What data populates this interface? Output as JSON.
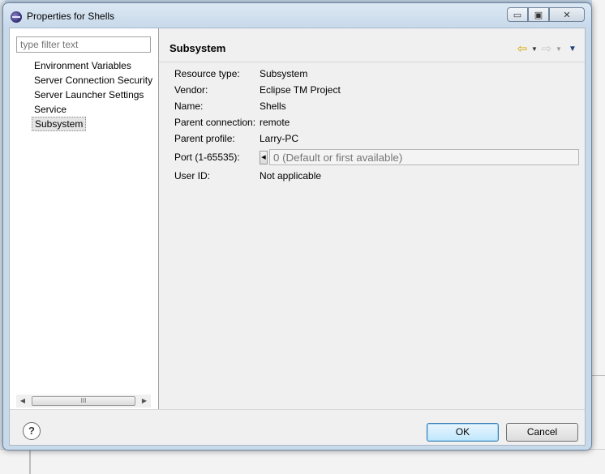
{
  "dialog": {
    "title": "Properties for Shells",
    "window_buttons": {
      "minimize": "▭",
      "maximize": "▣",
      "close": "✕"
    }
  },
  "sidebar": {
    "filter_placeholder": "type filter text",
    "items": [
      {
        "label": "Environment Variables"
      },
      {
        "label": "Server Connection Security"
      },
      {
        "label": "Server Launcher Settings"
      },
      {
        "label": "Service"
      },
      {
        "label": "Subsystem",
        "selected": true
      }
    ],
    "scroll_thumb": "III"
  },
  "page": {
    "title": "Subsystem",
    "properties": [
      {
        "label": "Resource type:",
        "value": "Subsystem"
      },
      {
        "label": "Vendor:",
        "value": "Eclipse TM Project"
      },
      {
        "label": "Name:",
        "value": "Shells"
      },
      {
        "label": "Parent connection:",
        "value": "remote"
      },
      {
        "label": "Parent profile:",
        "value": "Larry-PC"
      }
    ],
    "port": {
      "label": "Port (1-65535):",
      "placeholder": "0 (Default or first available)"
    },
    "user_id": {
      "label": "User ID:",
      "value": "Not applicable"
    }
  },
  "footer": {
    "help": "?",
    "ok_label": "OK",
    "cancel_label": "Cancel"
  },
  "colors": {
    "accent": "#3c7fb1",
    "nav_back": "#d6a500"
  }
}
